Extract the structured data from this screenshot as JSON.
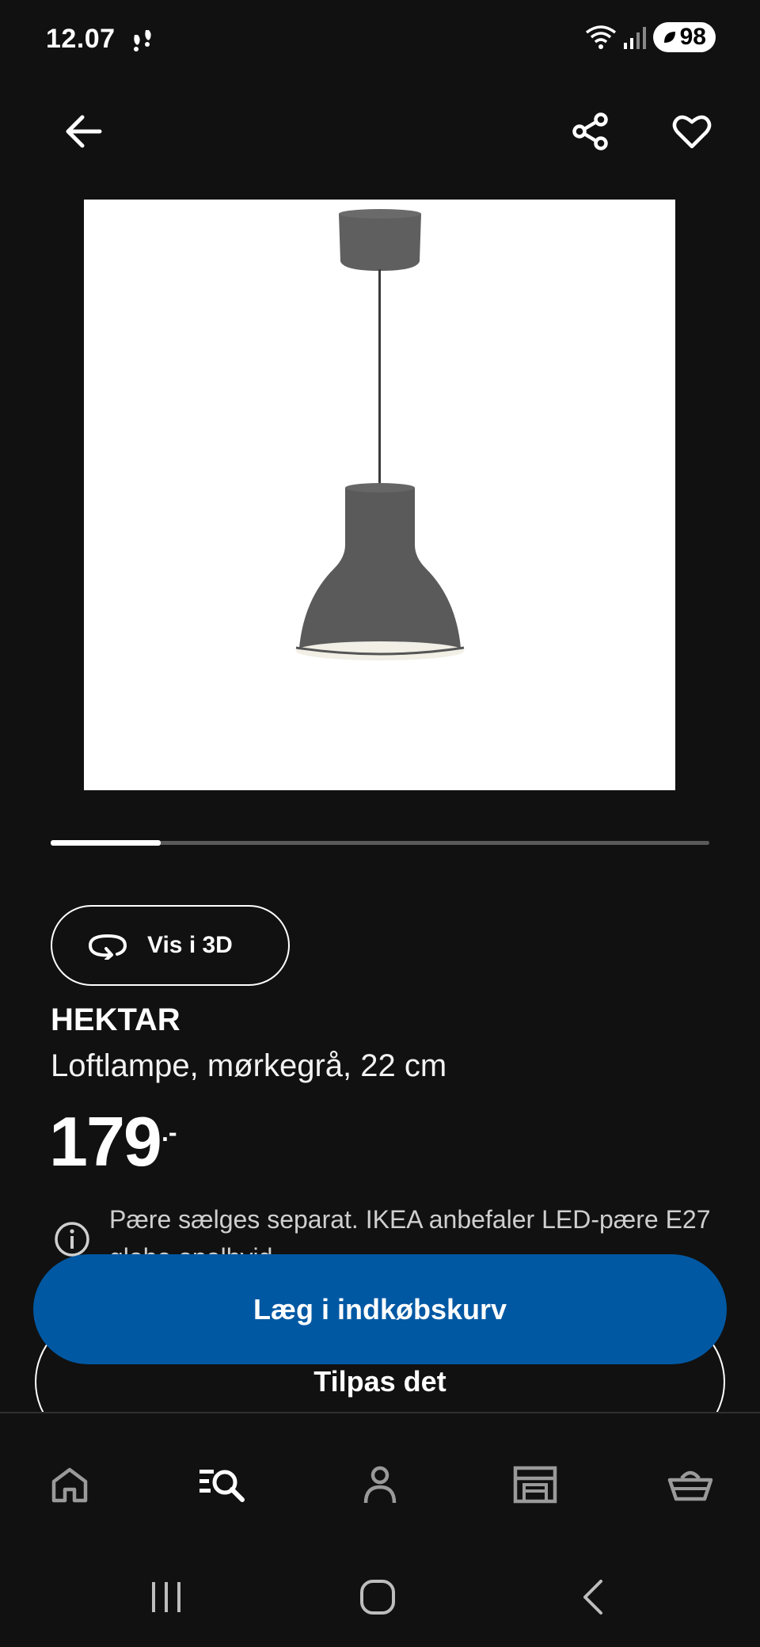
{
  "status_bar": {
    "time": "12.07",
    "battery": "98"
  },
  "top_nav": {
    "back_icon": "arrow-left-icon",
    "share_icon": "share-icon",
    "favorite_icon": "heart-icon"
  },
  "carousel": {
    "progress": 0.167
  },
  "view_3d": {
    "label": "Vis i 3D",
    "icon": "rotate-3d-icon"
  },
  "product": {
    "brand": "HEKTAR",
    "description": "Loftlampe, mørkegrå, 22 cm",
    "price": "179",
    "price_suffix": ".-",
    "info_text": "Pære sælges separat. IKEA anbefaler LED-pære E27 globe opalhvid."
  },
  "actions": {
    "add_to_cart": "Læg i indkøbskurv",
    "customize": "Tilpas det"
  },
  "bottom_nav": {
    "items": [
      {
        "icon": "home-icon"
      },
      {
        "icon": "search-list-icon"
      },
      {
        "icon": "profile-icon"
      },
      {
        "icon": "store-icon"
      },
      {
        "icon": "basket-icon"
      }
    ]
  },
  "colors": {
    "background": "#111111",
    "primary_button": "#0058a3",
    "text": "#ffffff"
  }
}
